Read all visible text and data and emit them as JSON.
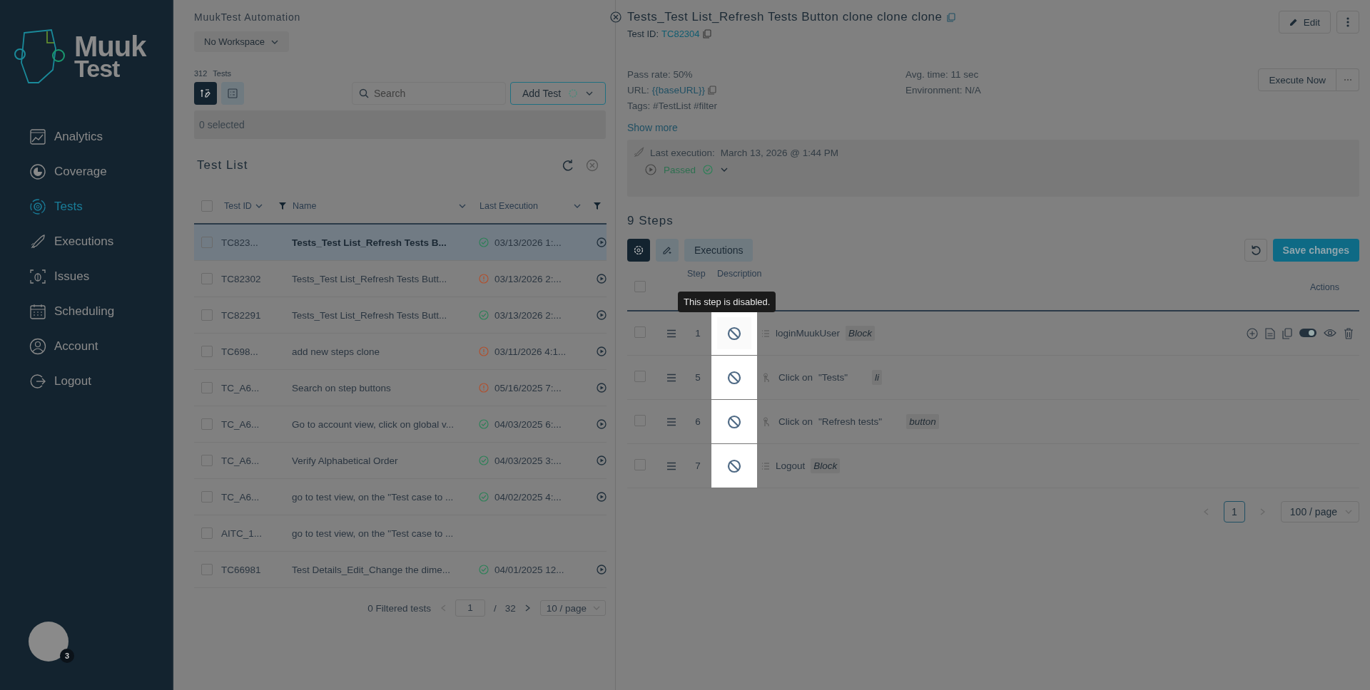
{
  "sidebar": {
    "logo_text": [
      "Muuk",
      "Test"
    ],
    "items": [
      {
        "label": "Analytics",
        "selected": false
      },
      {
        "label": "Coverage",
        "selected": false
      },
      {
        "label": "Tests",
        "selected": true
      },
      {
        "label": "Executions",
        "selected": false
      },
      {
        "label": "Issues",
        "selected": false
      },
      {
        "label": "Scheduling",
        "selected": false
      },
      {
        "label": "Account",
        "selected": false
      },
      {
        "label": "Logout",
        "selected": false
      }
    ],
    "notification_count": "3"
  },
  "list_panel": {
    "title": "MuukTest Automation",
    "workspace": "No Workspace",
    "count": "312",
    "count_label": "Tests",
    "views": [
      {
        "selected": true
      },
      {
        "selected": false
      }
    ],
    "search": {
      "placeholder": "Search"
    },
    "add_button": "Add Test",
    "selection": "0 selected",
    "list_title": "Test List",
    "columns": [
      "Test ID",
      "Name",
      "Last Execution"
    ],
    "all_checked": false,
    "rows": [
      {
        "id": "TC823...",
        "name": "Tests_Test List_Refresh Tests B...",
        "kind": "passed",
        "date": "03/13/2026 1:...",
        "selected": true,
        "checked": false
      },
      {
        "id": "TC82302",
        "name": "Tests_Test List_Refresh Tests Butt...",
        "kind": "failed",
        "date": "03/13/2026 2:...",
        "selected": false,
        "checked": false
      },
      {
        "id": "TC82291",
        "name": "Tests_Test List_Refresh Tests Butt...",
        "kind": "passed",
        "date": "03/13/2026 2:...",
        "selected": false,
        "checked": false
      },
      {
        "id": "TC698...",
        "name": "add new steps clone",
        "kind": "failed",
        "date": "03/11/2026 4:1...",
        "selected": false,
        "checked": false
      },
      {
        "id": "TC_A6...",
        "name": "Search on step buttons",
        "kind": "failed",
        "date": "05/16/2025 7:...",
        "selected": false,
        "checked": false
      },
      {
        "id": "TC_A6...",
        "name": "Go to account view, click on global v...",
        "kind": "passed",
        "date": "04/03/2025 6:...",
        "selected": false,
        "checked": false
      },
      {
        "id": "TC_A6...",
        "name": "Verify Alphabetical Order",
        "kind": "passed",
        "date": "04/03/2025 3:...",
        "selected": false,
        "checked": false
      },
      {
        "id": "TC_A6...",
        "name": "go to test view, on the \"Test case to ...",
        "kind": "passed",
        "date": "04/02/2025 4:...",
        "selected": false,
        "checked": false
      },
      {
        "id": "AITC_1...",
        "name": "go to test view, on the \"Test case to ...",
        "kind": "unexecuted",
        "selected": false,
        "checked": false
      },
      {
        "id": "TC66981",
        "name": "Test Details_Edit_Change the dime...",
        "kind": "passed",
        "date": "04/01/2025 12...",
        "selected": false,
        "checked": false
      }
    ],
    "filtered": "0 Filtered tests",
    "page": "1",
    "page_separator": "/",
    "pages": "32",
    "page_size": "10 / page"
  },
  "detail": {
    "title": "Tests_Test List_Refresh Tests Button clone clone clone",
    "test_id_label": "Test ID:",
    "test_id": "TC82304",
    "edit_button": "Edit",
    "execute_button": "Execute Now",
    "pass_rate": "Pass rate: 50%",
    "url_label": "URL:",
    "url": "{{baseURL}}",
    "tags": "Tags: #TestList #filter",
    "avg_time": "Avg. time: 11 sec",
    "environment": "Environment: N/A",
    "show_more": "Show more",
    "last_execution_label": "Last execution:",
    "last_execution": "March 13, 2026 @ 1:44 PM",
    "result": {
      "label": "Passed",
      "kind": "passed"
    },
    "steps_title": "9 Steps",
    "toolbar_tabs": [
      {
        "kind": "icon",
        "selected": true
      },
      {
        "kind": "icon",
        "selected": false
      },
      {
        "kind": "text",
        "label": "Executions",
        "selected": false
      }
    ],
    "save_button": "Save changes",
    "step_columns": [
      "Step",
      "Description",
      "Actions"
    ],
    "all_checked": false,
    "steps": [
      {
        "number": "1",
        "kind": "block",
        "text": "loginMuukUser",
        "tag": "Block",
        "disabled": true,
        "checked": false,
        "show_actions": true
      },
      {
        "number": "5",
        "kind": "action",
        "action": "Click on",
        "target": "\"Tests\"",
        "tag": "li",
        "disabled": true,
        "checked": false,
        "show_actions": false
      },
      {
        "number": "6",
        "kind": "action",
        "action": "Click on",
        "target": "\"Refresh tests\"",
        "tag": "button",
        "disabled": true,
        "checked": false,
        "show_actions": false
      },
      {
        "number": "7",
        "kind": "block",
        "text": "Logout",
        "tag": "Block",
        "disabled": true,
        "checked": false,
        "show_actions": false
      }
    ],
    "tooltip": "This step is disabled.",
    "page": "1",
    "page_size": "100 / page"
  }
}
